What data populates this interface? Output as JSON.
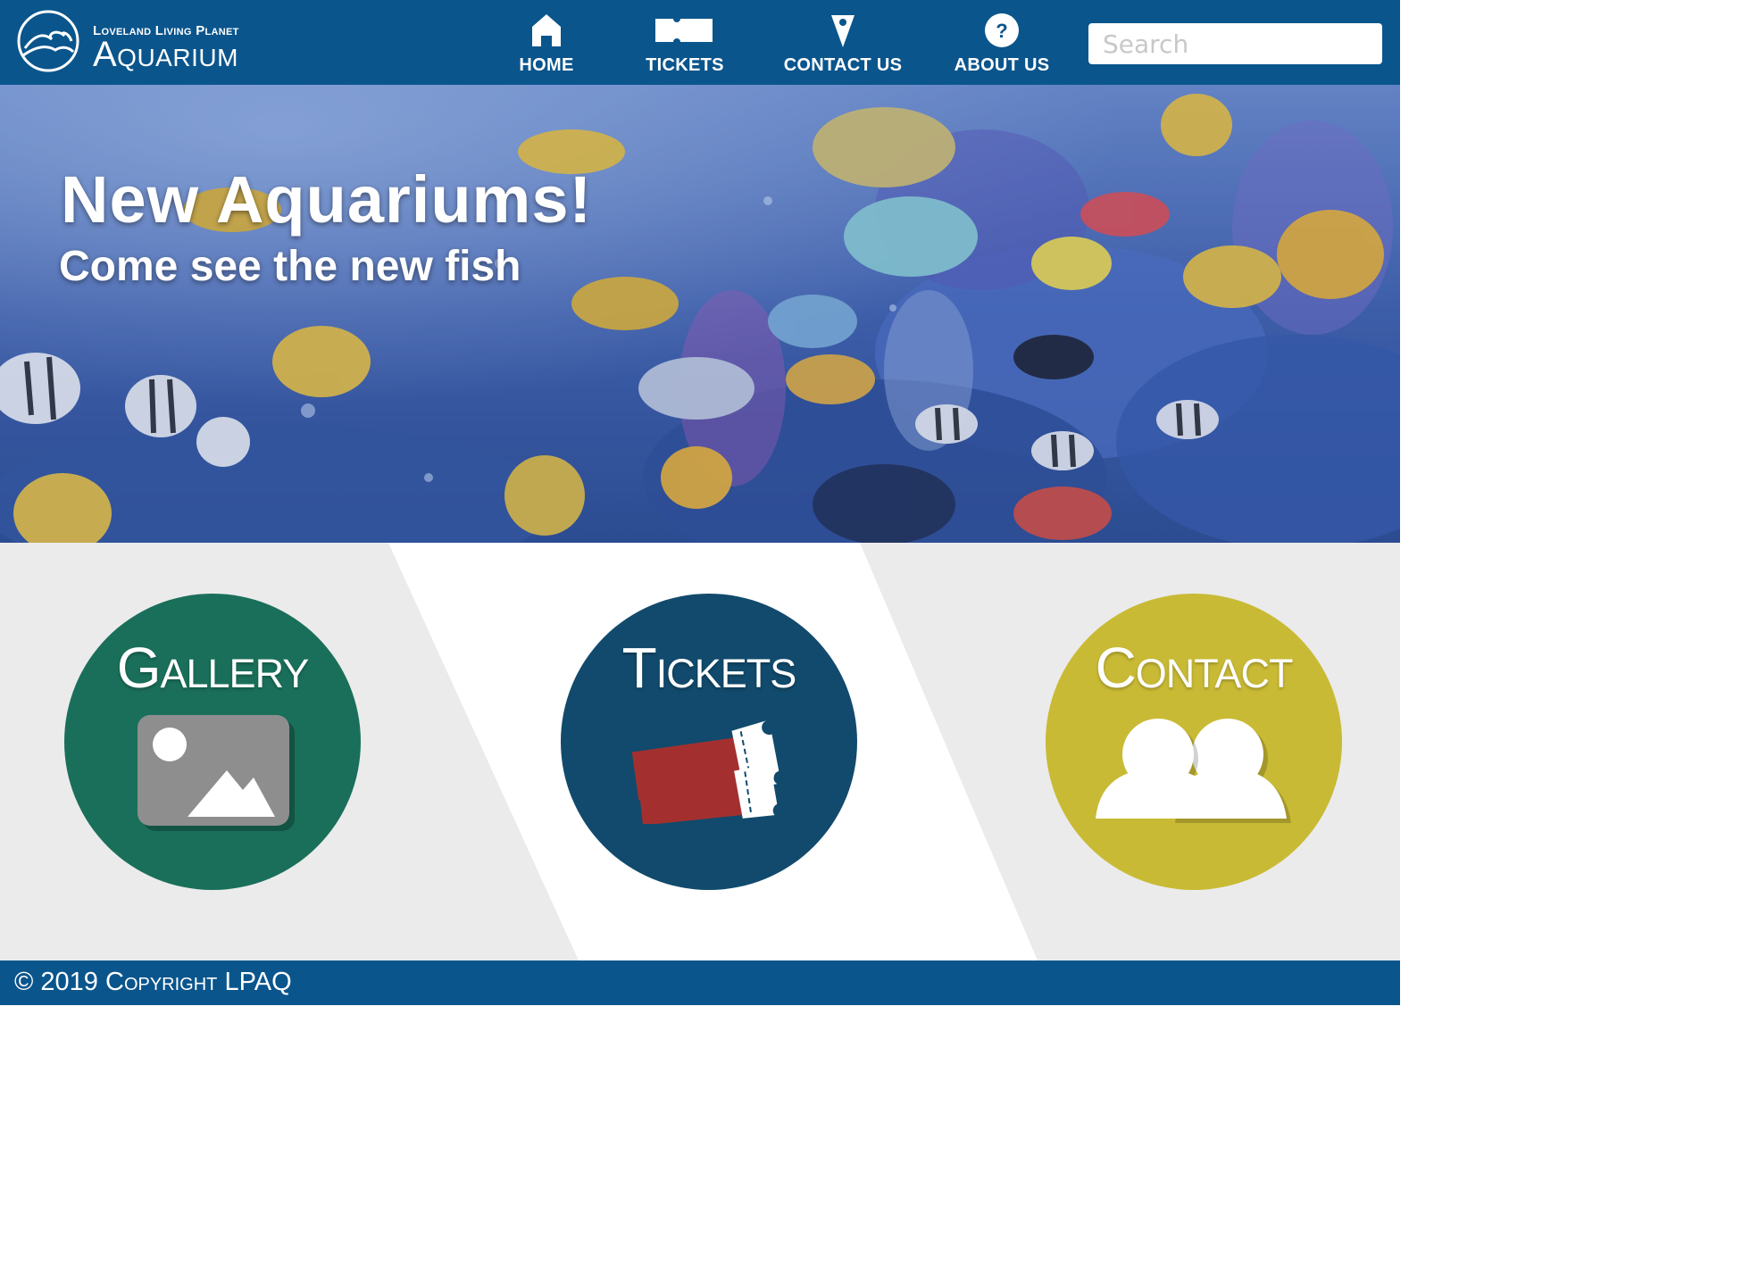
{
  "header": {
    "logo_small": "Loveland Living Planet",
    "logo_big": "Aquarium",
    "brand_color": "#0a558c",
    "nav": [
      {
        "label": "HOME",
        "icon": "home-icon"
      },
      {
        "label": "TICKETS",
        "icon": "ticket-icon"
      },
      {
        "label": "CONTACT US",
        "icon": "map-pin-icon"
      },
      {
        "label": "ABOUT US",
        "icon": "question-icon"
      }
    ],
    "search_placeholder": "Search"
  },
  "hero": {
    "title": "New Aquariums!",
    "subtitle": "Come see the new fish",
    "image": "coral-reef-fish-illustration"
  },
  "tiles": [
    {
      "label": "Gallery",
      "icon": "image-icon",
      "color": "#1a6f5a"
    },
    {
      "label": "Tickets",
      "icon": "tickets-icon",
      "color": "#114a6c"
    },
    {
      "label": "Contact",
      "icon": "people-icon",
      "color": "#c9ba35"
    }
  ],
  "footer": {
    "copyright": "© 2019 Copyright LPAQ"
  }
}
